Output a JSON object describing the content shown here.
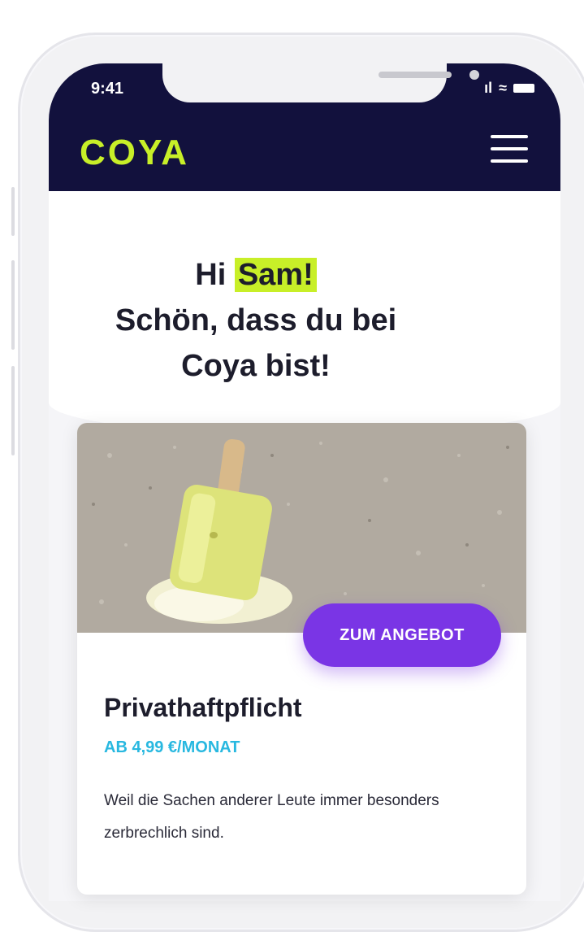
{
  "status_bar": {
    "time": "9:41",
    "signal": "ıl",
    "wifi": "≈"
  },
  "header": {
    "logo": "COYA"
  },
  "greeting": {
    "prefix": "Hi ",
    "name": "Sam!",
    "line2": "Schön, dass du bei",
    "line3": "Coya bist!"
  },
  "offer": {
    "button_label": "ZUM ANGEBOT",
    "title": "Privathaftpflicht",
    "price": "AB 4,99 €/MONAT",
    "description": "Weil die Sachen anderer Leute immer besonders zerbrechlich sind."
  },
  "colors": {
    "brand_navy": "#12113d",
    "accent_lime": "#c8ef28",
    "cta_purple": "#7a35e5",
    "price_cyan": "#28b8e0"
  },
  "icons": {
    "menu": "hamburger-icon",
    "hero_image": "melted-ice-cream-image"
  }
}
